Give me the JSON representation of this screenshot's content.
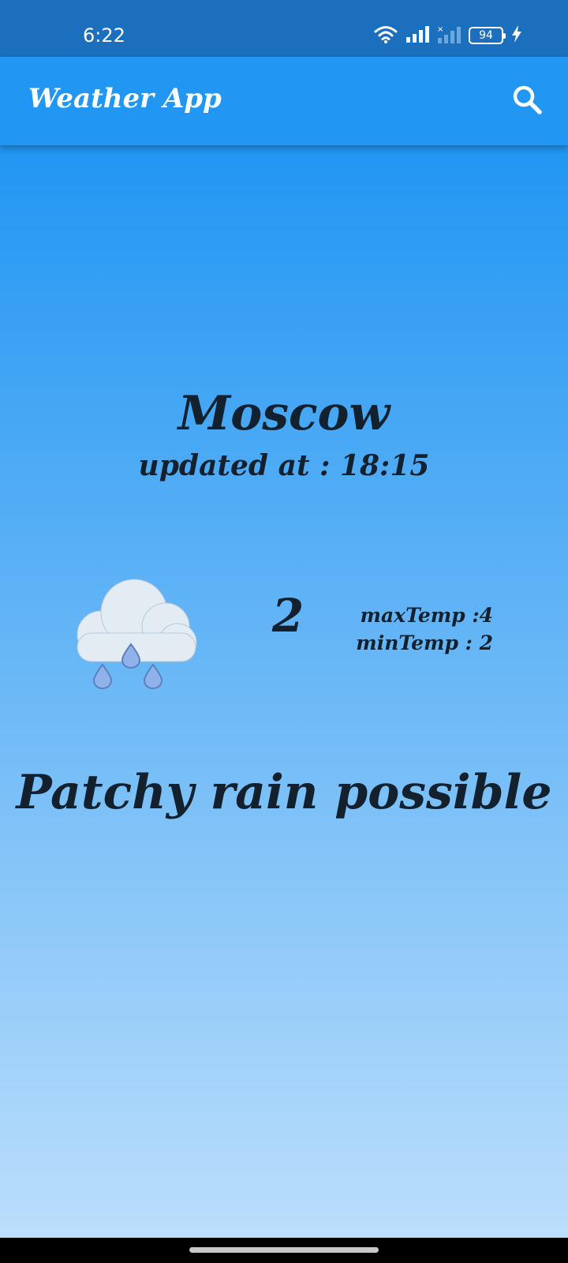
{
  "status_bar": {
    "time": "6:22",
    "battery_level": "94",
    "icons": [
      "wifi-icon",
      "signal-icon",
      "signal-no-service-icon",
      "battery-icon",
      "charging-icon"
    ]
  },
  "app_bar": {
    "title": "Weather App",
    "search_icon": "search-icon",
    "background_color": "#2196f3"
  },
  "weather": {
    "city": "Moscow",
    "updated_label": "updated at : 18:15",
    "temperature": "2",
    "max_temp_label": "maxTemp :4",
    "min_temp_label": "minTemp : 2",
    "condition": "Patchy rain possible",
    "condition_icon": "cloud-rain-icon"
  },
  "colors": {
    "status_bar": "#1b6fbc",
    "gradient_top": "#2196f3",
    "gradient_bottom": "#bbdefb",
    "text": "#13212f"
  }
}
